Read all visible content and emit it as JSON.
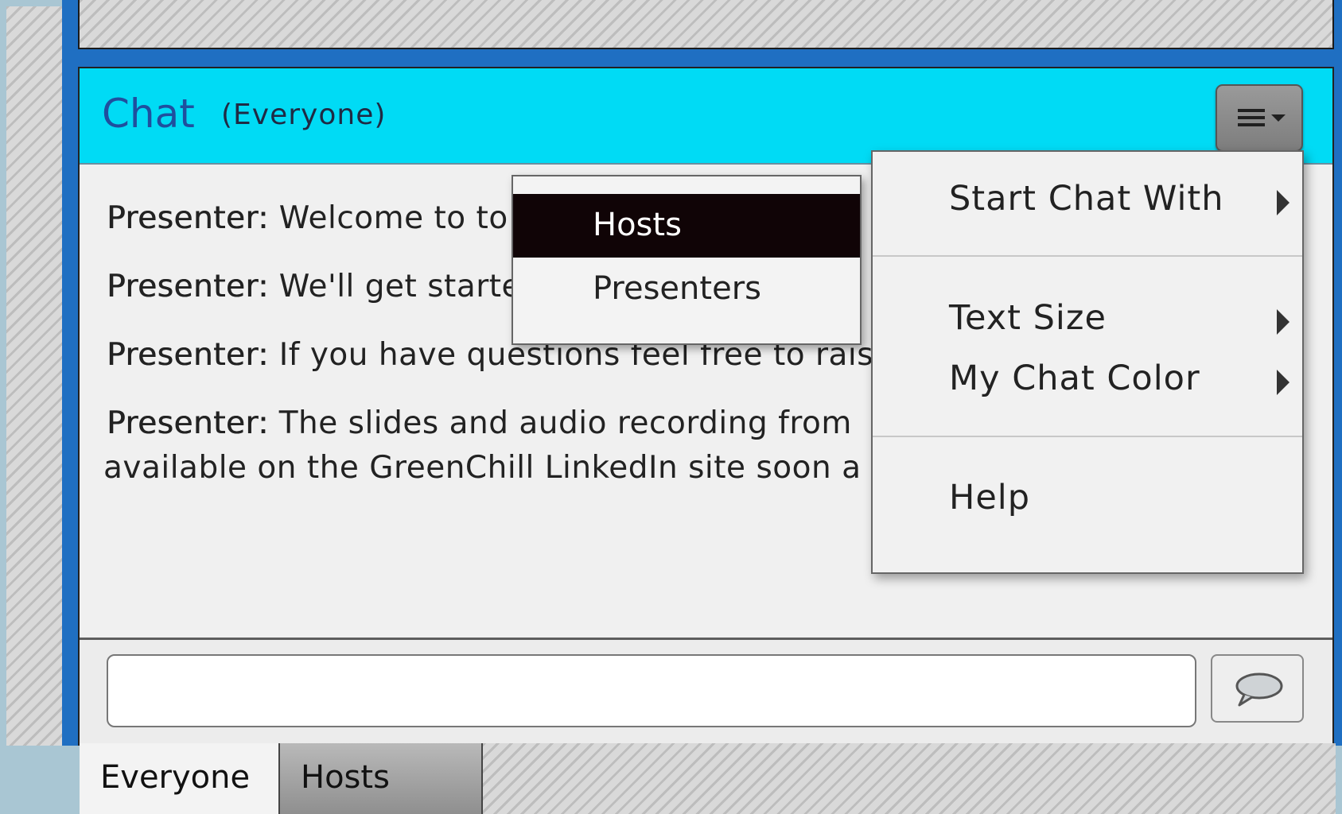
{
  "chat": {
    "title": "Chat",
    "subtitle": "(Everyone)",
    "messages": [
      {
        "sender": "Presenter:",
        "text": "Welcome to to"
      },
      {
        "sender": "Presenter:",
        "text": "We'll get starte"
      },
      {
        "sender": "Presenter:",
        "text": "If you have questions feel free to rais"
      },
      {
        "sender": "Presenter:",
        "text": "The slides and audio recording from",
        "continuation": "available on the GreenChill LinkedIn site soon a"
      }
    ],
    "input_value": "",
    "tabs": [
      {
        "label": "Everyone",
        "selected": true
      },
      {
        "label": "Hosts",
        "selected": false
      }
    ]
  },
  "options_menu": {
    "items": [
      {
        "label": "Start Chat With",
        "has_submenu": true
      },
      {
        "label": "Text Size",
        "has_submenu": true
      },
      {
        "label": "My Chat Color",
        "has_submenu": true
      },
      {
        "label": "Help",
        "has_submenu": false
      }
    ]
  },
  "start_chat_submenu": {
    "items": [
      {
        "label": "Hosts",
        "highlighted": true
      },
      {
        "label": "Presenters",
        "highlighted": false
      }
    ]
  },
  "colors": {
    "header_bg": "#00dbf5",
    "frame_blue": "#1f6fc2",
    "title_blue": "#1f4f9e",
    "highlight_bg": "#100406"
  },
  "icons": {
    "menu": "hamburger-dropdown-icon",
    "send": "speech-bubble-icon",
    "submenu": "triangle-right-icon"
  }
}
